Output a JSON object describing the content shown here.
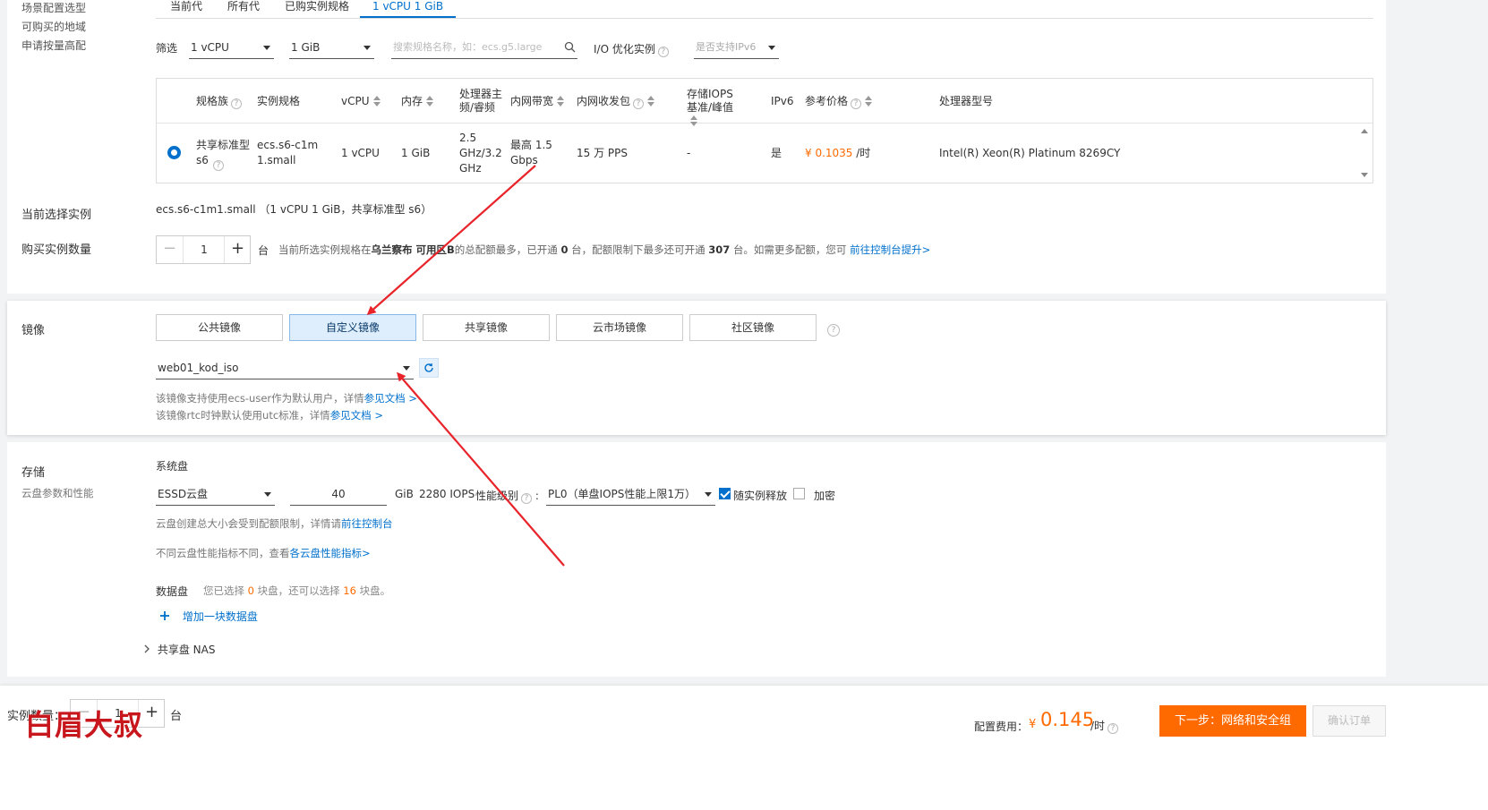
{
  "left_labels": {
    "scene": "场景配置选型",
    "regions": "可购买的地域",
    "quota": "申请按量高配",
    "current_instance": "当前选择实例",
    "buy_count": "购买实例数量",
    "image": "镜像",
    "storage": "存储",
    "storage_sub": "云盘参数和性能"
  },
  "tabs": [
    {
      "label": "当前代",
      "active": false
    },
    {
      "label": "所有代",
      "active": false
    },
    {
      "label": "已购实例规格",
      "active": false
    },
    {
      "label": "1 vCPU 1 GiB",
      "active": true
    }
  ],
  "filter": {
    "label": "筛选",
    "vcpu": "1 vCPU",
    "mem": "1 GiB",
    "search_placeholder": "搜索规格名称，如：ecs.g5.large",
    "io_label": "I/O 优化实例",
    "ipv6_placeholder": "是否支持IPv6"
  },
  "table": {
    "headers": {
      "family": "规格族",
      "spec": "实例规格",
      "vcpu": "vCPU",
      "mem": "内存",
      "freq": "处理器主频/睿频",
      "bandwidth": "内网带宽",
      "pps": "内网收发包",
      "iops": "存储IOPS基准/峰值",
      "ipv6": "IPv6",
      "price": "参考价格",
      "cpu": "处理器型号"
    },
    "row": {
      "family": "共享标准型 s6",
      "spec": "ecs.s6-c1m1.small",
      "vcpu": "1 vCPU",
      "mem": "1 GiB",
      "freq": "2.5 GHz/3.2 GHz",
      "bandwidth": "最高 1.5 Gbps",
      "pps": "15 万 PPS",
      "iops": "-",
      "ipv6": "是",
      "price": "¥ 0.1035",
      "price_unit": "/时",
      "cpu": "Intel(R) Xeon(R) Platinum 8269CY"
    }
  },
  "current_instance_value": "ecs.s6-c1m1.small （1 vCPU 1 GiB，共享标准型 s6）",
  "buy": {
    "count": "1",
    "unit": "台",
    "note_prefix": "当前所选实例规格在",
    "note_region": "乌兰察布 可用区B",
    "note_mid1": "的总配额最多，已开通",
    "note_opened": "0",
    "note_mid2": "台，配额限制下最多还可开通",
    "note_max": "307",
    "note_mid3": "台。如需更多配额，您可",
    "note_link": "前往控制台提升>"
  },
  "image": {
    "buttons": [
      "公共镜像",
      "自定义镜像",
      "共享镜像",
      "云市场镜像",
      "社区镜像"
    ],
    "active_index": 1,
    "selected": "web01_kod_iso",
    "note1": "该镜像支持使用ecs-user作为默认用户，详情",
    "note1_link": "参见文档 >",
    "note2": "该镜像rtc时钟默认使用utc标准，详情",
    "note2_link": "参见文档 >"
  },
  "storage": {
    "system_disk": "系统盘",
    "disk_type": "ESSD云盘",
    "size": "40",
    "size_unit": "GiB",
    "iops": "2280 IOPS",
    "perf_label": "性能级别",
    "perf_value": "PL0（单盘IOPS性能上限1万）",
    "release_label": "随实例释放",
    "encrypt_label": "加密",
    "note1": "云盘创建总大小会受到配额限制，详情请",
    "note1_link": "前往控制台",
    "note2": "不同云盘性能指标不同，查看",
    "note2_link": "各云盘性能指标>",
    "data_disk": "数据盘",
    "data_note_a": "您已选择",
    "data_selected": "0",
    "data_note_b": "块盘，还可以选择",
    "data_remain": "16",
    "data_note_c": "块盘。",
    "add_disk": "增加一块数据盘",
    "nas": "共享盘 NAS"
  },
  "footer": {
    "count_label": "实例数量：",
    "count": "1",
    "unit": "台",
    "watermark": "白眉大叔",
    "cost_label": "配置费用：",
    "currency": "¥",
    "price": "0.145",
    "price_unit": "/时",
    "next_button": "下一步：网络和安全组",
    "confirm_button": "确认订单"
  },
  "colors": {
    "accent": "#0070cc",
    "orange": "#ff6a00",
    "annotation": "#e8232a"
  }
}
